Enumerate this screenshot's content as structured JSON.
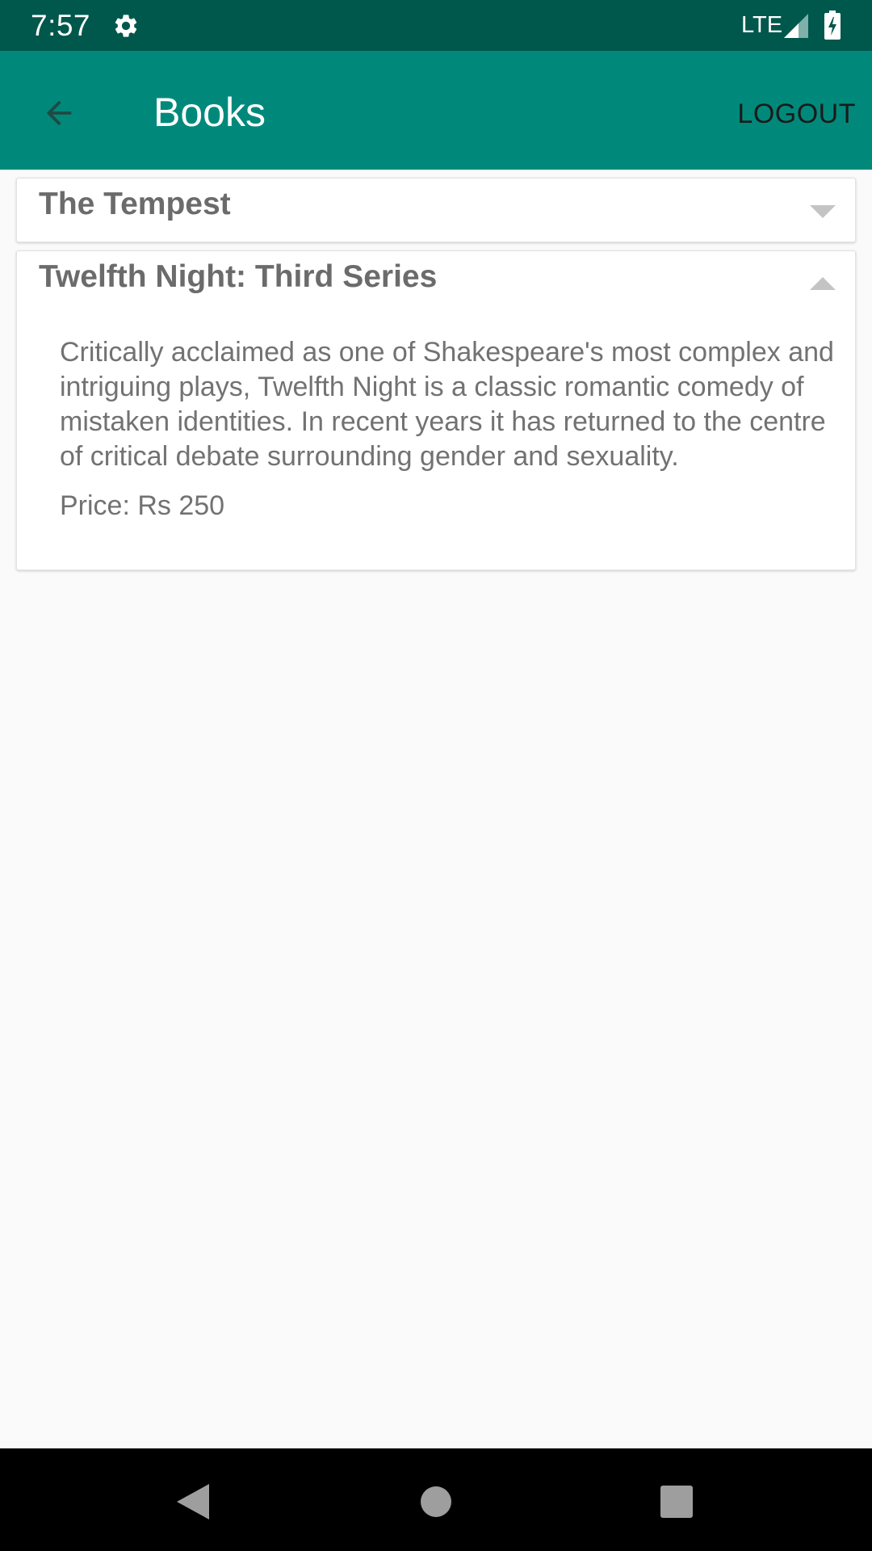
{
  "status_bar": {
    "time": "7:57",
    "network": "LTE",
    "icons": [
      "gear-icon",
      "signal-icon",
      "battery-charging-icon"
    ]
  },
  "app_bar": {
    "title": "Books",
    "back_icon": "arrow-back-icon",
    "logout_label": "LOGOUT",
    "colors": {
      "app_bar": "#00897b",
      "status_bar": "#00574b"
    }
  },
  "books": [
    {
      "title": "The Tempest",
      "expanded": false,
      "toggle_icon": "chevron-down-icon"
    },
    {
      "title": "Twelfth Night: Third Series",
      "expanded": true,
      "toggle_icon": "chevron-up-icon",
      "description": "Critically acclaimed as one of Shakespeare's most complex and intriguing plays, Twelfth Night is a classic romantic comedy of mistaken identities. In recent years it has returned to the centre of critical debate surrounding gender and sexuality.",
      "price": "Price: Rs 250"
    }
  ],
  "nav_bar": {
    "buttons": [
      "nav-back-icon",
      "nav-home-icon",
      "nav-recents-icon"
    ]
  }
}
